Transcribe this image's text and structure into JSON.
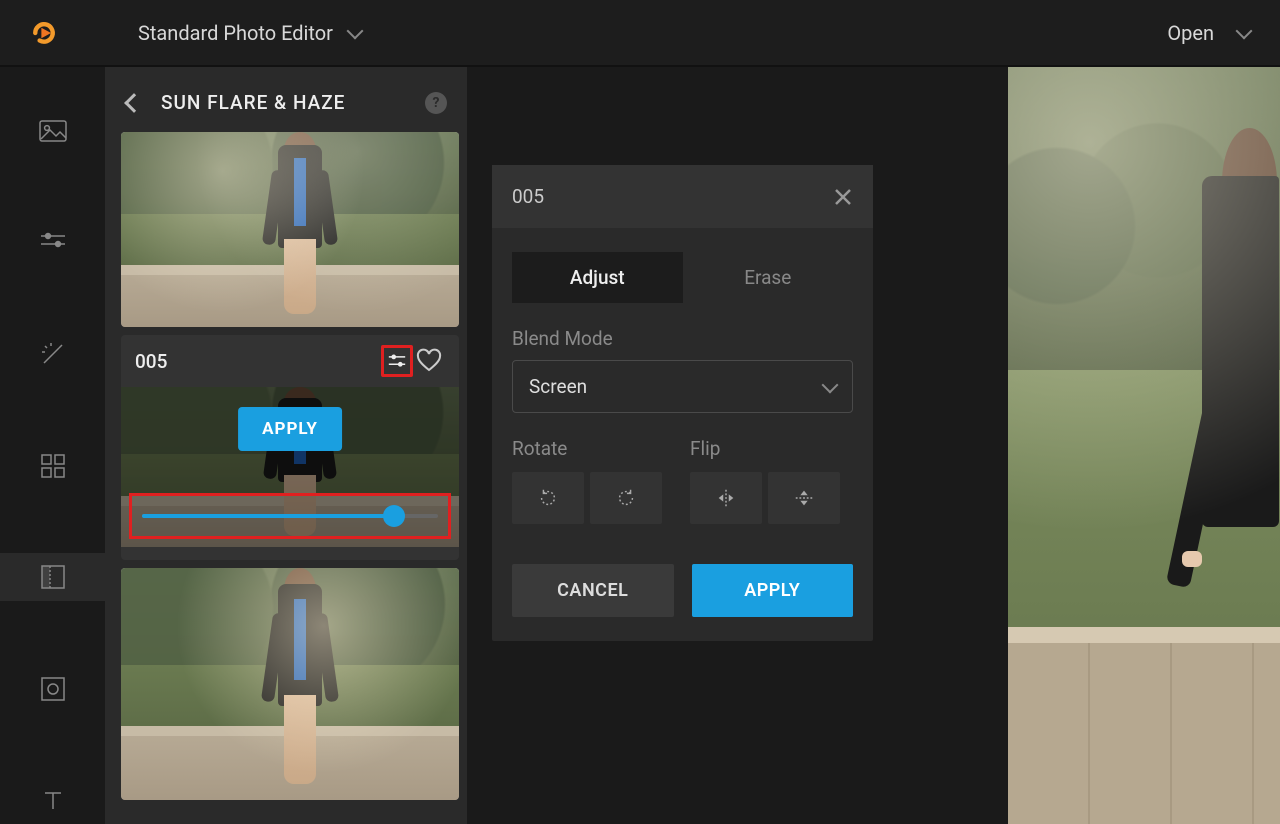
{
  "topbar": {
    "title": "Standard Photo Editor",
    "open_label": "Open"
  },
  "panel": {
    "title": "SUN FLARE & HAZE"
  },
  "effect_card": {
    "label": "005",
    "apply": "APPLY",
    "slider_value_pct": 85
  },
  "settings_popover": {
    "title": "005",
    "tabs": {
      "adjust": "Adjust",
      "erase": "Erase"
    },
    "blend_mode_label": "Blend Mode",
    "blend_mode_value": "Screen",
    "rotate_label": "Rotate",
    "flip_label": "Flip",
    "cancel": "CANCEL",
    "apply": "APPLY"
  },
  "colors": {
    "accent": "#1a9fe0",
    "highlight": "#e02020"
  }
}
